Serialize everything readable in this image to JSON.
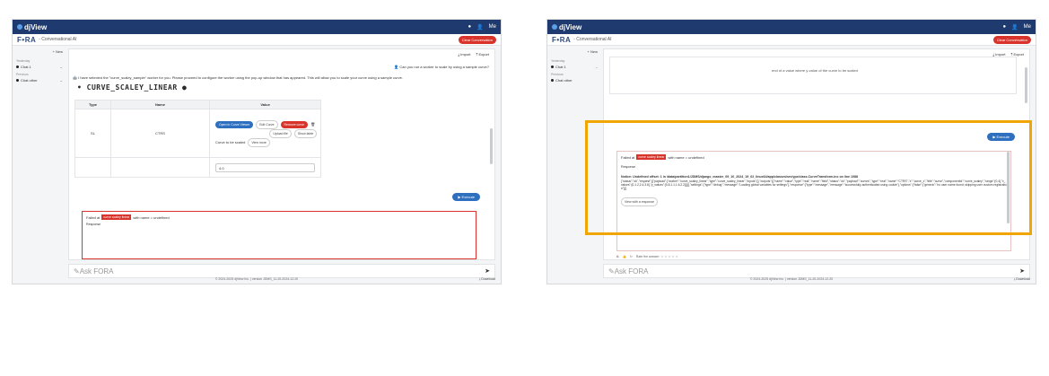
{
  "app": {
    "logo_text": "djView",
    "brand": "F•RA",
    "subtitle": "- Conversational AI",
    "clear_label": "Clear Conversation",
    "user_menu": "Me",
    "new_label": "+ New",
    "import_label": "Import",
    "export_label": "Export",
    "ask_placeholder": "Ask FORA",
    "footer": "© 2024-2025 djView Inc. | version JDMS_11-20-2024-12.20",
    "download_label": "Download"
  },
  "sidebar": {
    "group1": "Yesterday",
    "group2": "Previous",
    "items": [
      {
        "label": "Chat 1"
      },
      {
        "label": "Chat other"
      }
    ]
  },
  "left": {
    "user_msg": "Can you run a worker to scale by using a sample curve?",
    "bot_msg": "I have selected the \"curve_scaley_sample\" worker for you. Please proceed to configure the worker using the pop-up window that has appeared. This will allow you to scale your curve using a sample curve.",
    "worker_title": "CURVE_SCALEY_LINEAR",
    "table": {
      "headers": [
        "Type",
        "Name",
        "Value"
      ],
      "row1": {
        "type": "SL",
        "name": "CTRS",
        "btn_open": "Open in Curve Viewer",
        "btn_edit": "Edit Curve",
        "btn_remove": "Remove curve",
        "curve_note": "Curve to be scaled",
        "btn_view": "View more",
        "upload": "Upload file",
        "show": "Show table"
      },
      "row2_value": "4.0"
    },
    "execute_label": "Execute",
    "err_prefix": "Failed at",
    "err_tag": "curve scaley linear",
    "err_suffix": "with name = undefined",
    "response_label": "Response"
  },
  "right": {
    "row_text": "end of a value where y-value of the curve to be scaled",
    "execute_label": "Execute",
    "err_prefix": "Failed at",
    "err_tag": "curve scaley linear",
    "err_suffix": "with name = undefined",
    "response_label": "Response",
    "notice": "Notice: Undefined offset: 1 in /data/partition1/JDMS/django_master_09_10_2024_19_02_linux64/app/classes/src/ype/class.CurveTransform.inc on line 1088",
    "json_dump": "{\"status\":\"ok\",\"request\":[{\"payload\":{\"worker\":\"curve_scaley_linear\",\"type\":\"curve_scaley_linear\",\"inputs\":[],\"outputs\":[{\"name\":\"value\",\"type\":\"real\",\"name\":\"field\",\"status\":\"ok\",\"payload\":\"curves\",\"type\":\"real\",\"name\":\"CTRS\",\"x\":\"curve_x\",\"title\":\"curve\",\"componentId\":\"curve_scaley\",\"range\":[0,4],\"x_values\":[0,1.2,2.4,3.6],\"y_values\":[0.8,1.1,1.6,2.2]}]}],\"settings\":{\"type\":\"debug\",\"message\":\"Loading global variables for settings\"},\"response\":{\"type\":\"message\",\"message\":\"successfully authenticated using cookie\"},\"options\":{\"false\":{\"generic\":\"no user name found; skipping user custom registration\"}}}",
    "view_response": "View with a response",
    "rating_label": "Rate the answer: ☆ ☆ ☆ ☆ ☆"
  }
}
